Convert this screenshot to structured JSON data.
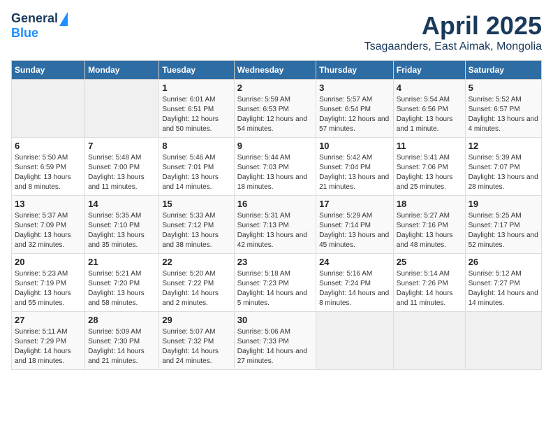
{
  "logo": {
    "general": "General",
    "blue": "Blue"
  },
  "title": "April 2025",
  "subtitle": "Tsagaanders, East Aimak, Mongolia",
  "days_of_week": [
    "Sunday",
    "Monday",
    "Tuesday",
    "Wednesday",
    "Thursday",
    "Friday",
    "Saturday"
  ],
  "weeks": [
    [
      {
        "day": "",
        "info": ""
      },
      {
        "day": "",
        "info": ""
      },
      {
        "day": "1",
        "info": "Sunrise: 6:01 AM\nSunset: 6:51 PM\nDaylight: 12 hours and 50 minutes."
      },
      {
        "day": "2",
        "info": "Sunrise: 5:59 AM\nSunset: 6:53 PM\nDaylight: 12 hours and 54 minutes."
      },
      {
        "day": "3",
        "info": "Sunrise: 5:57 AM\nSunset: 6:54 PM\nDaylight: 12 hours and 57 minutes."
      },
      {
        "day": "4",
        "info": "Sunrise: 5:54 AM\nSunset: 6:56 PM\nDaylight: 13 hours and 1 minute."
      },
      {
        "day": "5",
        "info": "Sunrise: 5:52 AM\nSunset: 6:57 PM\nDaylight: 13 hours and 4 minutes."
      }
    ],
    [
      {
        "day": "6",
        "info": "Sunrise: 5:50 AM\nSunset: 6:59 PM\nDaylight: 13 hours and 8 minutes."
      },
      {
        "day": "7",
        "info": "Sunrise: 5:48 AM\nSunset: 7:00 PM\nDaylight: 13 hours and 11 minutes."
      },
      {
        "day": "8",
        "info": "Sunrise: 5:46 AM\nSunset: 7:01 PM\nDaylight: 13 hours and 14 minutes."
      },
      {
        "day": "9",
        "info": "Sunrise: 5:44 AM\nSunset: 7:03 PM\nDaylight: 13 hours and 18 minutes."
      },
      {
        "day": "10",
        "info": "Sunrise: 5:42 AM\nSunset: 7:04 PM\nDaylight: 13 hours and 21 minutes."
      },
      {
        "day": "11",
        "info": "Sunrise: 5:41 AM\nSunset: 7:06 PM\nDaylight: 13 hours and 25 minutes."
      },
      {
        "day": "12",
        "info": "Sunrise: 5:39 AM\nSunset: 7:07 PM\nDaylight: 13 hours and 28 minutes."
      }
    ],
    [
      {
        "day": "13",
        "info": "Sunrise: 5:37 AM\nSunset: 7:09 PM\nDaylight: 13 hours and 32 minutes."
      },
      {
        "day": "14",
        "info": "Sunrise: 5:35 AM\nSunset: 7:10 PM\nDaylight: 13 hours and 35 minutes."
      },
      {
        "day": "15",
        "info": "Sunrise: 5:33 AM\nSunset: 7:12 PM\nDaylight: 13 hours and 38 minutes."
      },
      {
        "day": "16",
        "info": "Sunrise: 5:31 AM\nSunset: 7:13 PM\nDaylight: 13 hours and 42 minutes."
      },
      {
        "day": "17",
        "info": "Sunrise: 5:29 AM\nSunset: 7:14 PM\nDaylight: 13 hours and 45 minutes."
      },
      {
        "day": "18",
        "info": "Sunrise: 5:27 AM\nSunset: 7:16 PM\nDaylight: 13 hours and 48 minutes."
      },
      {
        "day": "19",
        "info": "Sunrise: 5:25 AM\nSunset: 7:17 PM\nDaylight: 13 hours and 52 minutes."
      }
    ],
    [
      {
        "day": "20",
        "info": "Sunrise: 5:23 AM\nSunset: 7:19 PM\nDaylight: 13 hours and 55 minutes."
      },
      {
        "day": "21",
        "info": "Sunrise: 5:21 AM\nSunset: 7:20 PM\nDaylight: 13 hours and 58 minutes."
      },
      {
        "day": "22",
        "info": "Sunrise: 5:20 AM\nSunset: 7:22 PM\nDaylight: 14 hours and 2 minutes."
      },
      {
        "day": "23",
        "info": "Sunrise: 5:18 AM\nSunset: 7:23 PM\nDaylight: 14 hours and 5 minutes."
      },
      {
        "day": "24",
        "info": "Sunrise: 5:16 AM\nSunset: 7:24 PM\nDaylight: 14 hours and 8 minutes."
      },
      {
        "day": "25",
        "info": "Sunrise: 5:14 AM\nSunset: 7:26 PM\nDaylight: 14 hours and 11 minutes."
      },
      {
        "day": "26",
        "info": "Sunrise: 5:12 AM\nSunset: 7:27 PM\nDaylight: 14 hours and 14 minutes."
      }
    ],
    [
      {
        "day": "27",
        "info": "Sunrise: 5:11 AM\nSunset: 7:29 PM\nDaylight: 14 hours and 18 minutes."
      },
      {
        "day": "28",
        "info": "Sunrise: 5:09 AM\nSunset: 7:30 PM\nDaylight: 14 hours and 21 minutes."
      },
      {
        "day": "29",
        "info": "Sunrise: 5:07 AM\nSunset: 7:32 PM\nDaylight: 14 hours and 24 minutes."
      },
      {
        "day": "30",
        "info": "Sunrise: 5:06 AM\nSunset: 7:33 PM\nDaylight: 14 hours and 27 minutes."
      },
      {
        "day": "",
        "info": ""
      },
      {
        "day": "",
        "info": ""
      },
      {
        "day": "",
        "info": ""
      }
    ]
  ]
}
